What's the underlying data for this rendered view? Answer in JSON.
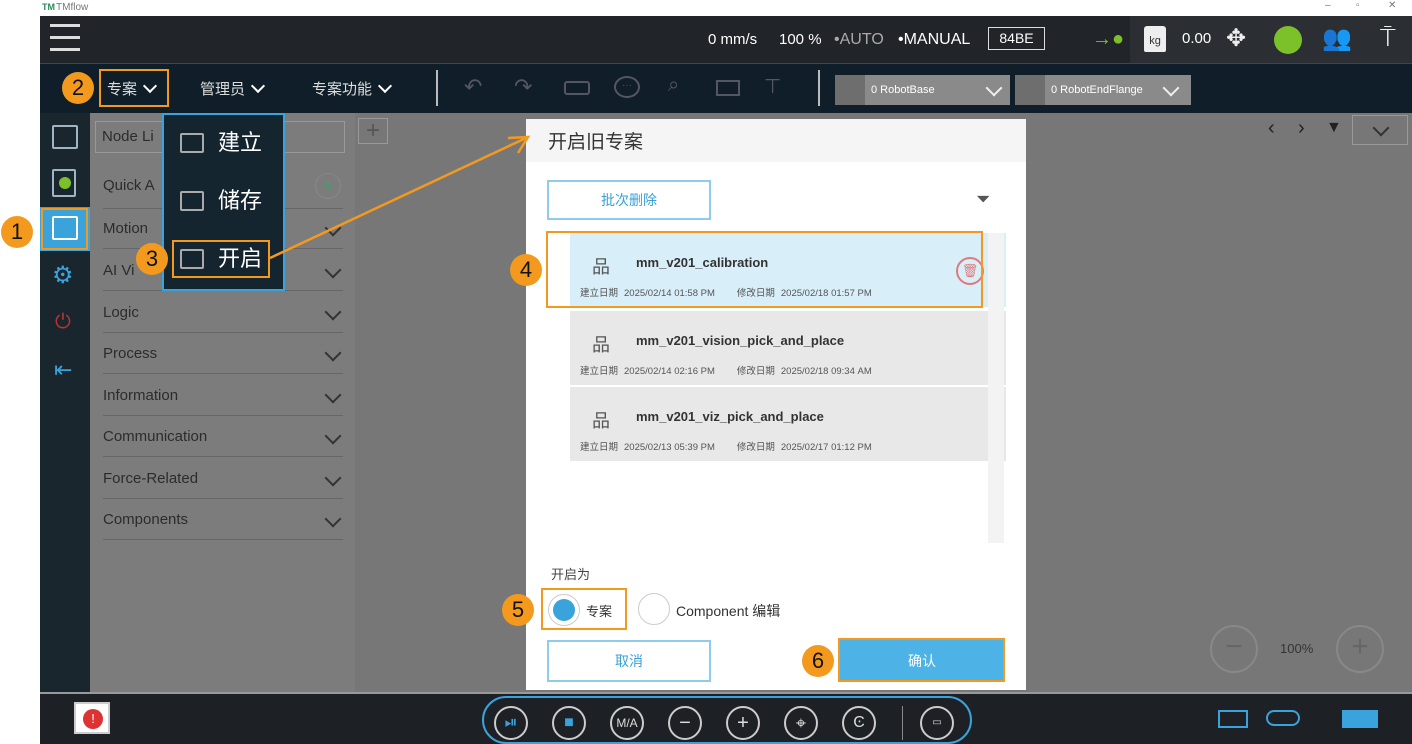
{
  "window": {
    "title": "TMflow"
  },
  "status": {
    "speed": "0 mm/s",
    "percent": "100 %",
    "auto": "•AUTO",
    "manual": "•MANUAL",
    "code": "84BE",
    "payload": "0.00",
    "kg": "kg"
  },
  "toolbar": {
    "project": "专案",
    "admin": "管理员",
    "project_functions": "专案功能",
    "base": "0 RobotBase",
    "tool": "0 RobotEndFlange"
  },
  "project_menu": {
    "items": [
      "建立",
      "储存",
      "开启"
    ]
  },
  "node_panel": {
    "node_list": "Node Li",
    "quick": "Quick A",
    "items": [
      "Motion",
      "AI Vi",
      "Logic",
      "Process",
      "Information",
      "Communication",
      "Force-Related",
      "Components"
    ]
  },
  "dialog": {
    "title": "开启旧专案",
    "batch_delete": "批次删除",
    "created_label": "建立日期",
    "modified_label": "修改日期",
    "projects": [
      {
        "name": "mm_v201_calibration",
        "created": "2025/02/14 01:58 PM",
        "modified": "2025/02/18 01:57 PM",
        "selected": true
      },
      {
        "name": "mm_v201_vision_pick_and_place",
        "created": "2025/02/14 02:16 PM",
        "modified": "2025/02/18 09:34 AM",
        "selected": false
      },
      {
        "name": "mm_v201_viz_pick_and_place",
        "created": "2025/02/13 05:39 PM",
        "modified": "2025/02/17 01:12 PM",
        "selected": false
      }
    ],
    "open_as": "开启为",
    "options": [
      {
        "label": "专案",
        "checked": true
      },
      {
        "label": "Component 编辑",
        "checked": false
      }
    ],
    "cancel": "取消",
    "confirm": "确认"
  },
  "zoom": {
    "level": "100%"
  },
  "bottombar": {
    "ma": "M/A"
  },
  "annotations": [
    "1",
    "2",
    "3",
    "4",
    "5",
    "6"
  ],
  "colors": {
    "accent": "#3aa3db",
    "annotation": "#f39a1e",
    "confirm": "#4db3e6",
    "selected_row": "#d8eef9"
  }
}
